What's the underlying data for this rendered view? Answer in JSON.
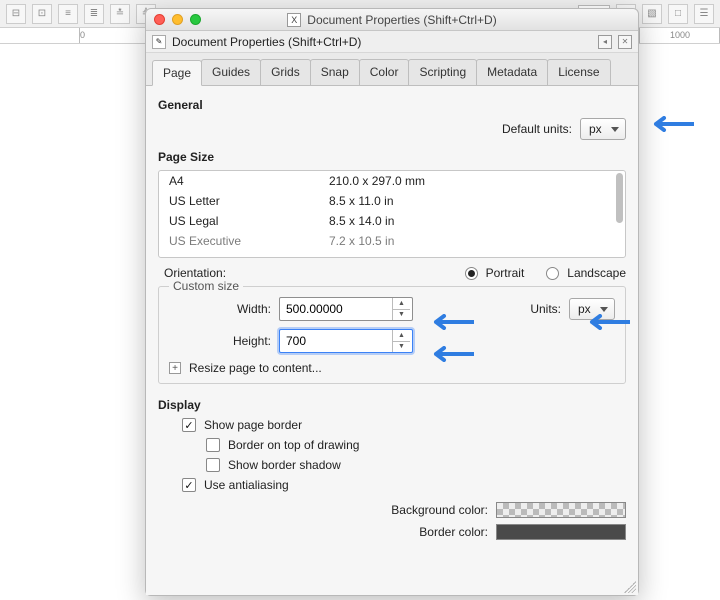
{
  "bg": {
    "px_select": "px",
    "ruler_marks": [
      "0",
      "1000"
    ]
  },
  "titlebar": {
    "title": "Document Properties (Shift+Ctrl+D)",
    "app_glyph": "X"
  },
  "subheader": {
    "title": "Document Properties (Shift+Ctrl+D)"
  },
  "tabs": [
    {
      "label": "Page"
    },
    {
      "label": "Guides"
    },
    {
      "label": "Grids"
    },
    {
      "label": "Snap"
    },
    {
      "label": "Color"
    },
    {
      "label": "Scripting"
    },
    {
      "label": "Metadata"
    },
    {
      "label": "License"
    }
  ],
  "general": {
    "heading": "General",
    "default_units_label": "Default units:",
    "default_units_value": "px"
  },
  "page_size": {
    "heading": "Page Size",
    "list": [
      {
        "name": "A4",
        "dim": "210.0 x 297.0 mm"
      },
      {
        "name": "US Letter",
        "dim": "8.5 x 11.0 in"
      },
      {
        "name": "US Legal",
        "dim": "8.5 x 14.0 in"
      },
      {
        "name": "US Executive",
        "dim": "7.2 x 10.5 in"
      }
    ],
    "orientation_label": "Orientation:",
    "portrait_label": "Portrait",
    "landscape_label": "Landscape"
  },
  "custom": {
    "legend": "Custom size",
    "width_label": "Width:",
    "height_label": "Height:",
    "units_label": "Units:",
    "width_value": "500.00000",
    "height_value": "700",
    "units_value": "px",
    "resize_label": "Resize page to content..."
  },
  "display": {
    "heading": "Display",
    "show_page_border": "Show page border",
    "border_on_top": "Border on top of drawing",
    "show_border_shadow": "Show border shadow",
    "use_aa": "Use antialiasing",
    "bg_color_label": "Background color:",
    "border_color_label": "Border color:"
  }
}
